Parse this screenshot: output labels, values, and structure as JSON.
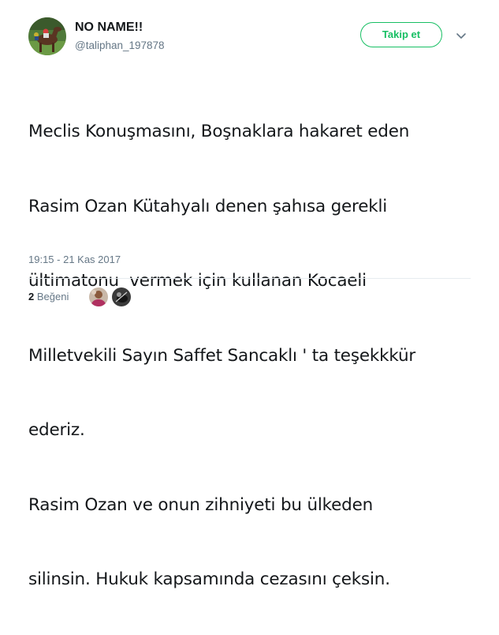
{
  "author": {
    "name": "NO NAME!!",
    "handle": "@taliphan_197878"
  },
  "follow_button": {
    "label": "Takip et"
  },
  "tweet": {
    "lines": [
      "Meclis Konuşmasını, Boşnaklara hakaret eden",
      "Rasim Ozan Kütahyalı denen şahısa gerekli",
      "ültimatonu  vermek için kullanan Kocaeli",
      "Milletvekili Sayın Saffet Sancaklı ' ta teşekkkür",
      "ederiz.",
      "Rasim Ozan ve onun zihniyeti bu ülkeden",
      "silinsin. Hukuk kapsamında cezasını çeksin."
    ],
    "timestamp": "19:15 - 21 Kas 2017"
  },
  "likes": {
    "count": "2",
    "label": "Beğeni"
  },
  "icons": {
    "avatar": "horse-racing-avatar",
    "caret": "chevron-down-icon",
    "likers": [
      "liker-avatar",
      "liker-avatar"
    ]
  },
  "colors": {
    "accent": "#17bf63",
    "secondary_text": "#657786",
    "primary_text": "#14171a",
    "divider": "#e6ecf0"
  }
}
